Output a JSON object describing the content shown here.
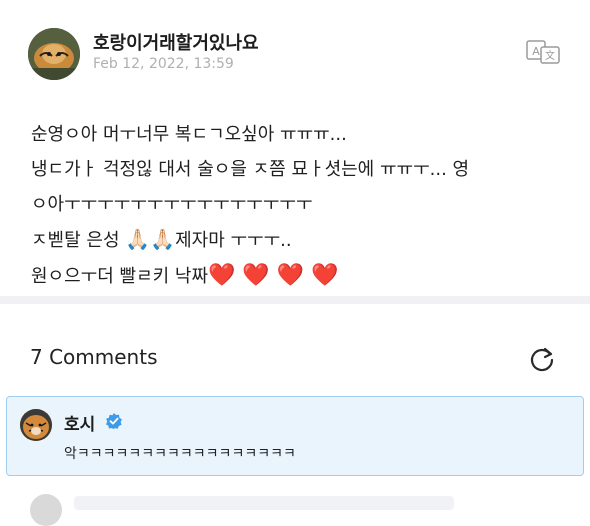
{
  "post": {
    "author": "호랑이거래할거있나요",
    "date": "Feb 12, 2022, 13:59",
    "lines": [
      "순영ㅇ아 머ㅜ너무 복ㄷㄱ오싶아 ㅠㅠㅠ...",
      "냉ㄷ가ㅏ 걱정읺 대서 술ㅇ을 ㅈ쯤 묘ㅏ셧는에 ㅠㅠㅜ... 영",
      "ㅇ아ㅜㅜㅜㅜㅜㅜㅜㅜㅜㅜㅜㅜㅜㅜㅜ",
      "ㅈ벧탈 은성",
      "제자마 ㅜㅜㅜ..",
      "원ㅇ으ㅜ더 빨ㄹ키 낙짜"
    ],
    "emoji_pray": "🙏🏻🙏🏻",
    "emoji_hearts": "❤️ ❤️ ❤️ ❤️"
  },
  "icons": {
    "translate": "translate-icon",
    "refresh": "refresh-icon",
    "verified": "verified-badge-icon"
  },
  "comments": {
    "title": "7 Comments",
    "items": [
      {
        "author": "호시",
        "text": "악ㅋㅋㅋㅋㅋㅋㅋㅋㅋㅋㅋㅋㅋㅋㅋㅋㅋ"
      }
    ]
  },
  "colors": {
    "verified": "#3d9be9",
    "highlight_bg": "#eaf4fd",
    "highlight_border": "#9fcef2",
    "heart": "#e0262f"
  }
}
